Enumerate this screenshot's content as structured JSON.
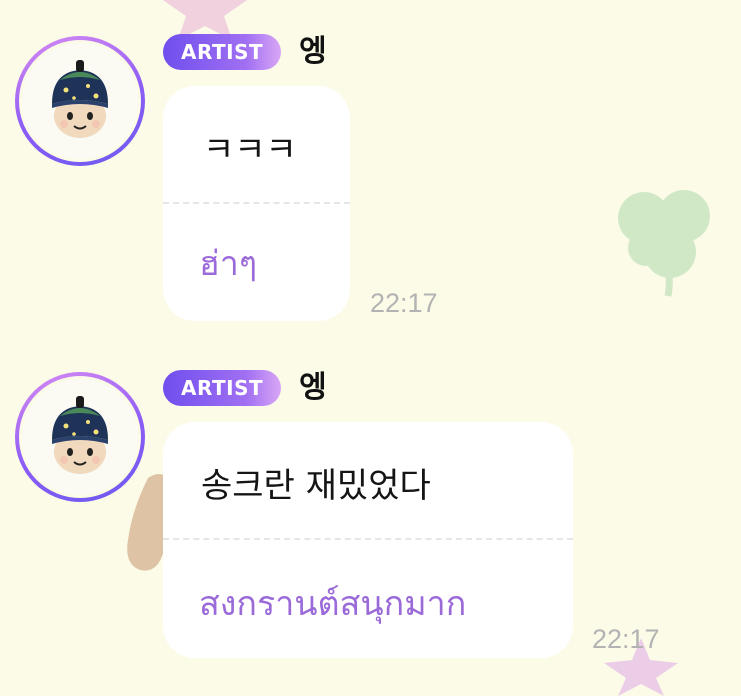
{
  "messages": [
    {
      "badge": "ARTIST",
      "sender": "엥",
      "text": "ㅋㅋㅋ",
      "translation": "ฮ่าๆ",
      "time": "22:17"
    },
    {
      "badge": "ARTIST",
      "sender": "엥",
      "text": "송크란 재밌었다",
      "translation": "สงกรานต์สนุกมาก",
      "time": "22:17"
    }
  ],
  "colors": {
    "background": "#fbfbe8",
    "badge_start": "#6f4fee",
    "badge_end": "#d9a6f5",
    "translation_text": "#9b6ad9",
    "timestamp_text": "#b3b3b3"
  },
  "icons": {
    "avatar": "knit-hat-character-avatar",
    "decorations": [
      "pink-star-sticker",
      "green-clover-sticker",
      "brown-blob-sticker"
    ]
  }
}
